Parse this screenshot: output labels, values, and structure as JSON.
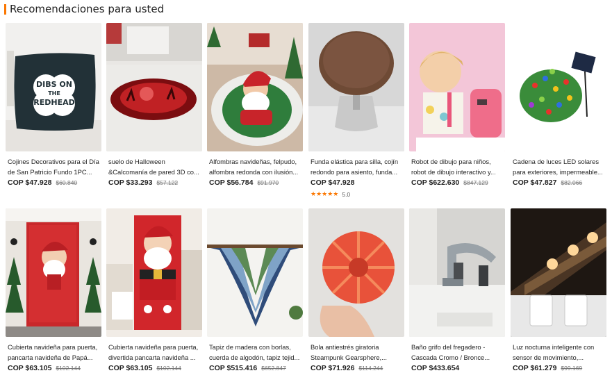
{
  "section_title": "Recomendaciones para usted",
  "colors": {
    "accent": "#fb7701"
  },
  "products": [
    {
      "name": "Cojines Decorativos para el Día de San Patricio Fundo 1PC...",
      "price": "COP $47.928",
      "old_price": "$60.840",
      "image": "pillow-image",
      "pillow_text": [
        "DIBS ON",
        "THE",
        "REDHEAD"
      ]
    },
    {
      "name": "suelo de Halloween &Calcomanía de pared 3D co...",
      "price": "COP $33.293",
      "old_price": "$57.122",
      "image": "halloween-floor-decal-image"
    },
    {
      "name": "Alfombras navideñas, felpudo, alfombra redonda con ilusión...",
      "price": "COP $56.784",
      "old_price": "$91.970",
      "image": "santa-rug-image"
    },
    {
      "name": "Funda elástica para silla, cojín redondo para asiento, funda...",
      "price": "COP $47.928",
      "old_price": "",
      "image": "stool-cover-image",
      "rating": "5.0",
      "stars": "★★★★★"
    },
    {
      "name": "Robot de dibujo para niños, robot de dibujo interactivo y...",
      "price": "COP $622.630",
      "old_price": "$847.129",
      "image": "drawing-robot-image"
    },
    {
      "name": "Cadena de luces LED solares para exteriores, impermeable...",
      "price": "COP $47.827",
      "old_price": "$82.066",
      "image": "solar-led-lights-image"
    },
    {
      "name": "Cubierta navideña para puerta, pancarta navideña de Papá...",
      "price": "COP $63.105",
      "old_price": "$102.144",
      "image": "santa-door-cover-image"
    },
    {
      "name": "Cubierta navideña para puerta, divertida pancarta navideña ...",
      "price": "COP $63.105",
      "old_price": "$102.144",
      "image": "santa-door-cover-2-image"
    },
    {
      "name": "Tapiz de madera con borlas, cuerda de algodón, tapiz tejid...",
      "price": "COP $515.416",
      "old_price": "$652.847",
      "image": "tapestry-image"
    },
    {
      "name": "Bola antiestrés giratoria Steampunk Gearsphere,...",
      "price": "COP $71.926",
      "old_price": "$114.244",
      "image": "gearsphere-image"
    },
    {
      "name": "Baño grifo del fregadero - Cascada Cromo / Bronce...",
      "price": "COP $433.654",
      "old_price": "",
      "image": "faucet-image"
    },
    {
      "name": "Luz nocturna inteligente con sensor de movimiento,...",
      "price": "COP $61.279",
      "old_price": "$99.169",
      "image": "night-light-image"
    }
  ]
}
